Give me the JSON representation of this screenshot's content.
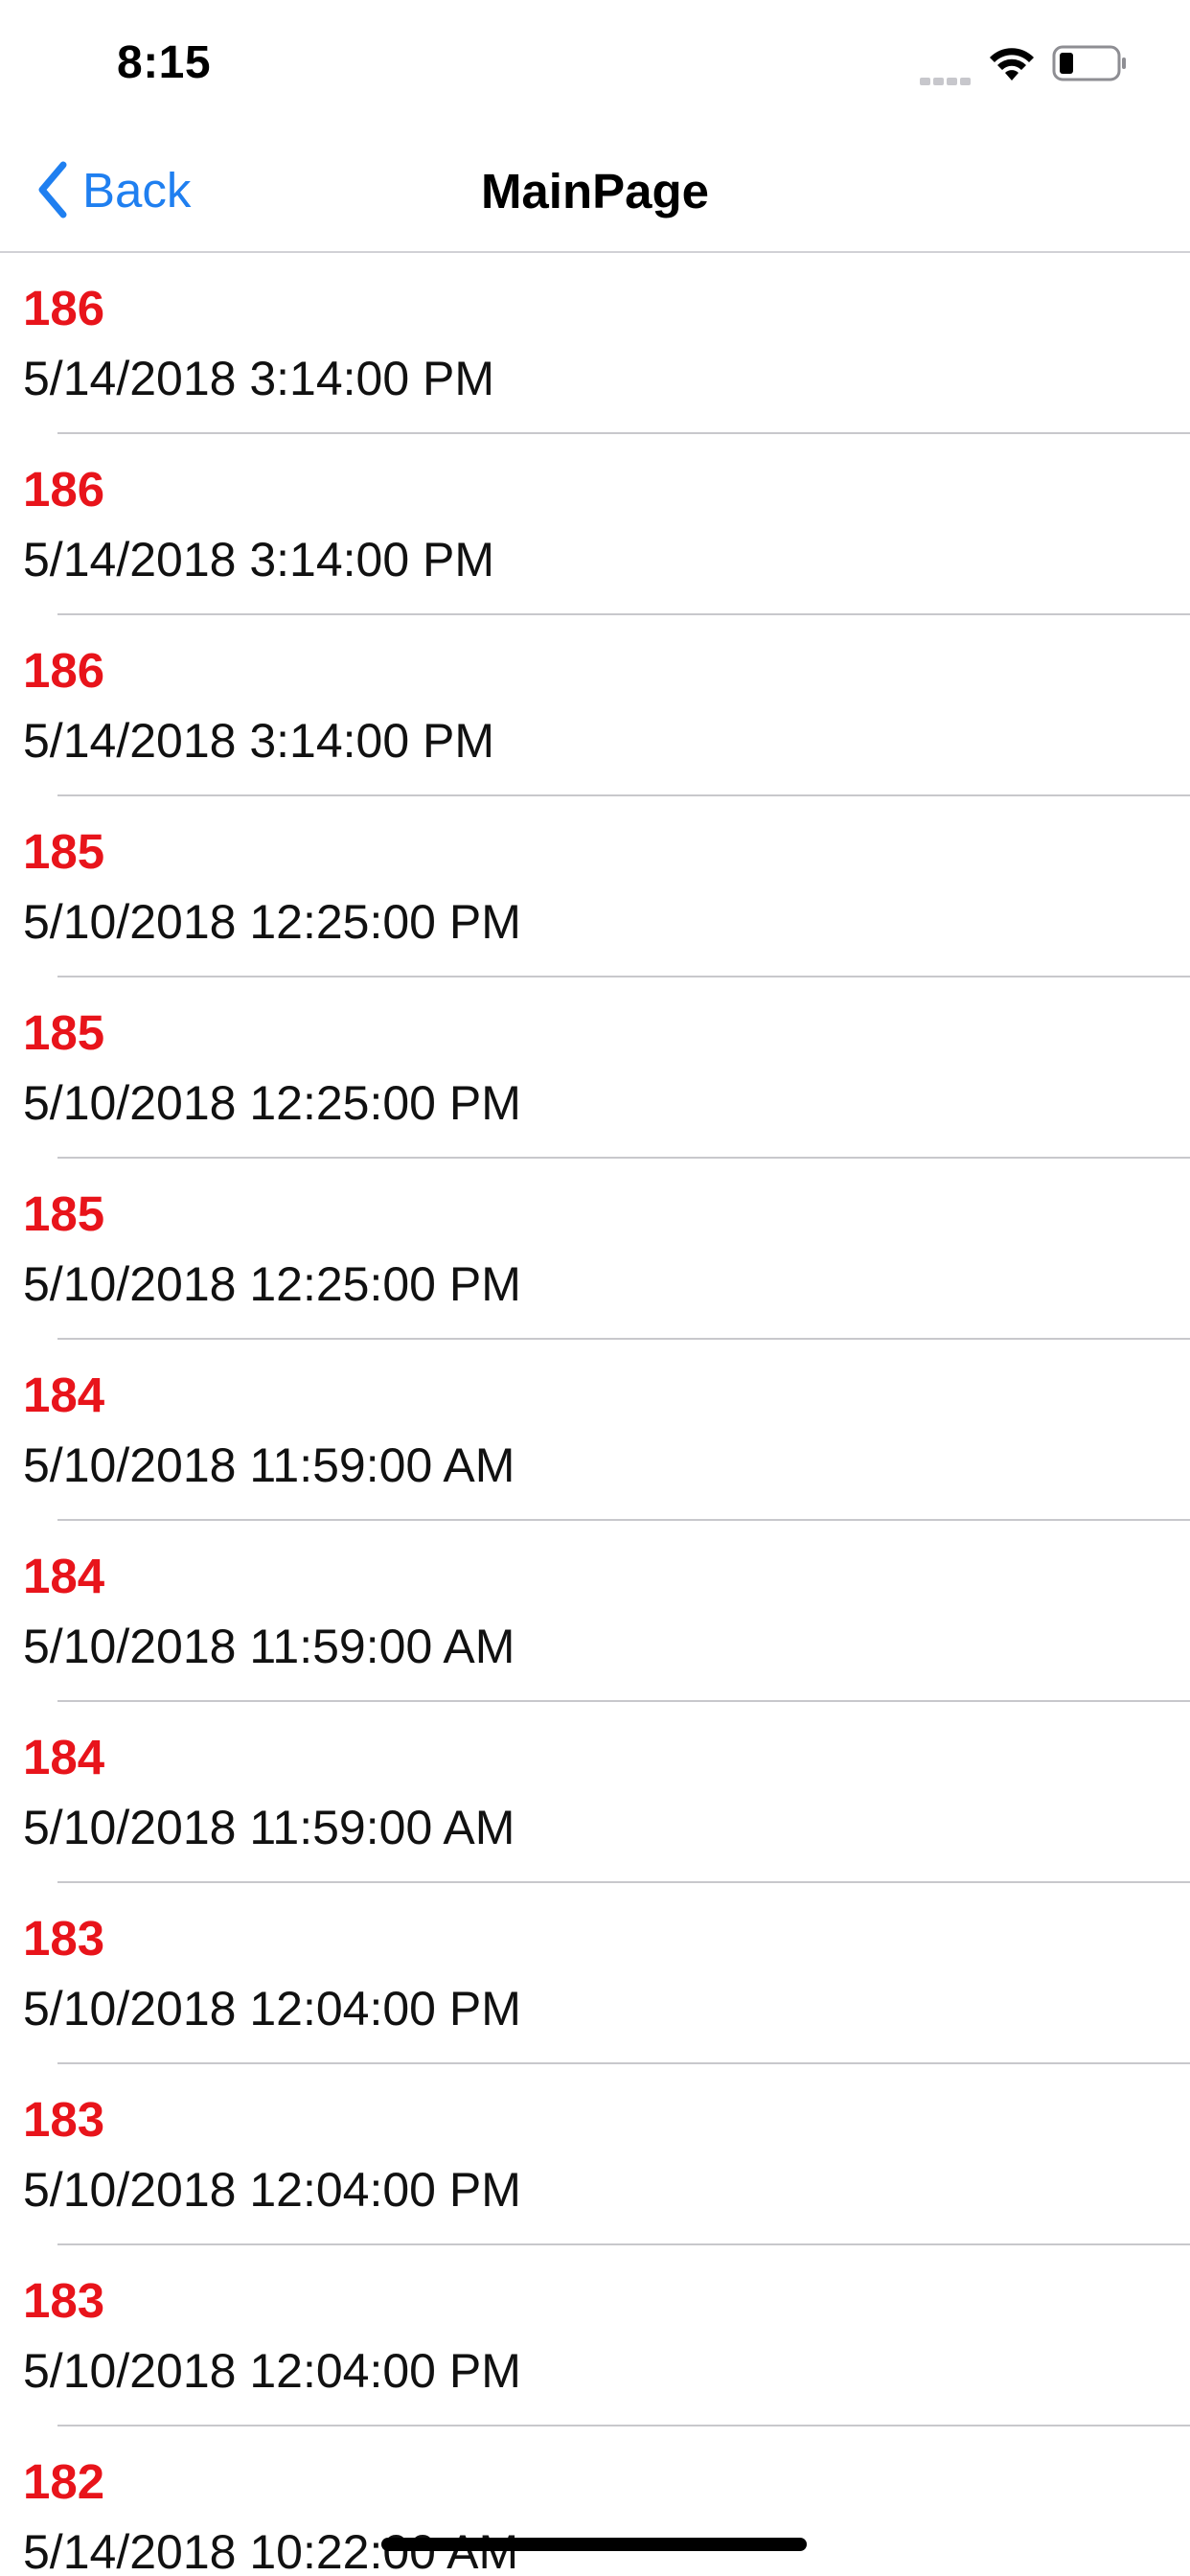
{
  "status_bar": {
    "time": "8:15",
    "signal_icon": "signal-dots-icon",
    "wifi_icon": "wifi-icon",
    "battery_icon": "battery-low-icon"
  },
  "nav": {
    "back_label": "Back",
    "back_icon": "chevron-left-icon",
    "title": "MainPage",
    "accent_color": "#1f7ff0"
  },
  "list": {
    "id_color": "#e8141b",
    "items": [
      {
        "id": "186",
        "date": "5/14/2018 3:14:00 PM"
      },
      {
        "id": "186",
        "date": "5/14/2018 3:14:00 PM"
      },
      {
        "id": "186",
        "date": "5/14/2018 3:14:00 PM"
      },
      {
        "id": "185",
        "date": "5/10/2018 12:25:00 PM"
      },
      {
        "id": "185",
        "date": "5/10/2018 12:25:00 PM"
      },
      {
        "id": "185",
        "date": "5/10/2018 12:25:00 PM"
      },
      {
        "id": "184",
        "date": "5/10/2018 11:59:00 AM"
      },
      {
        "id": "184",
        "date": "5/10/2018 11:59:00 AM"
      },
      {
        "id": "184",
        "date": "5/10/2018 11:59:00 AM"
      },
      {
        "id": "183",
        "date": "5/10/2018 12:04:00 PM"
      },
      {
        "id": "183",
        "date": "5/10/2018 12:04:00 PM"
      },
      {
        "id": "183",
        "date": "5/10/2018 12:04:00 PM"
      },
      {
        "id": "182",
        "date": "5/14/2018 10:22:00 AM"
      }
    ]
  }
}
